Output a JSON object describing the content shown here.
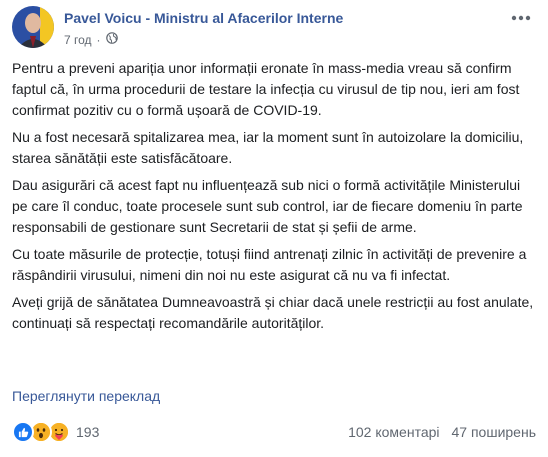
{
  "post": {
    "author": "Pavel Voicu - Ministru al Afacerilor Interne",
    "time": "7 год",
    "dot": "·",
    "paragraphs": [
      "Pentru a preveni apariția unor informații eronate în mass-media vreau să confirm faptul că, în urma procedurii de testare la infecția cu virusul de tip nou, ieri am fost confirmat pozitiv cu o formă ușoară de COVID-19.",
      "Nu a fost necesară spitalizarea mea, iar la moment sunt în autoizolare la domiciliu, starea sănătății este satisfăcătoare.",
      "Dau asigurări că acest fapt nu influențează sub nici o formă activitățile Ministerului pe care îl conduc, toate procesele sunt sub control, iar de fiecare domeniu în parte responsabili de gestionare sunt Secretarii de stat și șefii de arme.",
      "Cu toate măsurile de protecție, totuși fiind antrenați zilnic în activități de prevenire a răspândirii virusului, nimeni din noi nu este asigurat că nu va fi infectat.",
      "Aveți grijă de sănătatea Dumneavoastră și chiar dacă unele restricții au fost anulate, continuați să respectați recomandările autorităților."
    ],
    "translate_label": "Переглянути переклад",
    "reactions_count": "193",
    "comments": "102 коментарі",
    "shares": "47 поширень",
    "icons": {
      "privacy": "globe-icon",
      "more": "more-dots-icon",
      "like": "like-reaction-icon",
      "wow": "wow-reaction-icon",
      "care": "care-reaction-icon"
    },
    "colors": {
      "link": "#385898",
      "meta": "#606770",
      "like": "#1877f2",
      "emoji": "#f7b125"
    }
  }
}
